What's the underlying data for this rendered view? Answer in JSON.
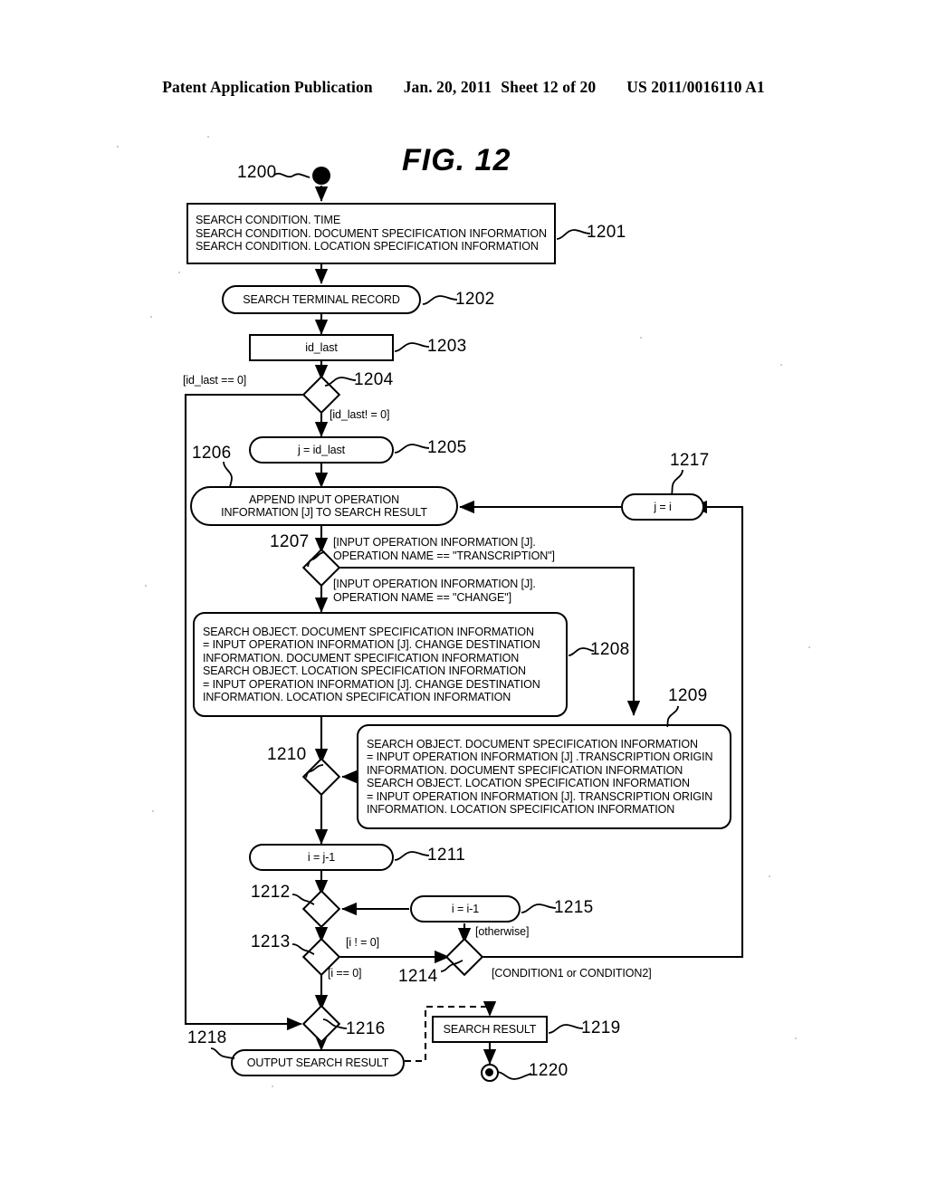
{
  "header": {
    "publication": "Patent Application Publication",
    "date": "Jan. 20, 2011",
    "sheet": "Sheet 12 of 20",
    "docnum": "US 2011/0016110 A1"
  },
  "figure": {
    "title": "FIG.  12"
  },
  "nodes": {
    "n1200": {
      "ref": "1200",
      "label": ""
    },
    "n1201": {
      "ref": "1201",
      "label": "SEARCH CONDITION. TIME\nSEARCH CONDITION. DOCUMENT SPECIFICATION INFORMATION\nSEARCH CONDITION. LOCATION SPECIFICATION INFORMATION"
    },
    "n1202": {
      "ref": "1202",
      "label": "SEARCH TERMINAL RECORD"
    },
    "n1203": {
      "ref": "1203",
      "label": "id_last"
    },
    "n1204": {
      "ref": "1204",
      "label": ""
    },
    "n1205": {
      "ref": "1205",
      "label": "j = id_last"
    },
    "n1206": {
      "ref": "1206",
      "label": "APPEND INPUT OPERATION\nINFORMATION [J] TO SEARCH RESULT"
    },
    "n1207": {
      "ref": "1207",
      "label": ""
    },
    "n1208": {
      "ref": "1208",
      "label": "SEARCH OBJECT. DOCUMENT SPECIFICATION INFORMATION\n= INPUT OPERATION INFORMATION [J]. CHANGE DESTINATION\nINFORMATION. DOCUMENT SPECIFICATION INFORMATION\nSEARCH OBJECT. LOCATION SPECIFICATION INFORMATION\n= INPUT OPERATION INFORMATION [J]. CHANGE DESTINATION\nINFORMATION. LOCATION SPECIFICATION INFORMATION"
    },
    "n1209": {
      "ref": "1209",
      "label": "SEARCH OBJECT. DOCUMENT SPECIFICATION INFORMATION\n= INPUT OPERATION INFORMATION [J] .TRANSCRIPTION ORIGIN\nINFORMATION. DOCUMENT SPECIFICATION INFORMATION\nSEARCH OBJECT. LOCATION SPECIFICATION INFORMATION\n= INPUT OPERATION INFORMATION [J]. TRANSCRIPTION ORIGIN\nINFORMATION. LOCATION SPECIFICATION INFORMATION"
    },
    "n1210": {
      "ref": "1210",
      "label": ""
    },
    "n1211": {
      "ref": "1211",
      "label": "i = j-1"
    },
    "n1212": {
      "ref": "1212",
      "label": ""
    },
    "n1213": {
      "ref": "1213",
      "label": ""
    },
    "n1214": {
      "ref": "1214",
      "label": ""
    },
    "n1215": {
      "ref": "1215",
      "label": "i = i-1"
    },
    "n1216": {
      "ref": "1216",
      "label": ""
    },
    "n1217": {
      "ref": "1217",
      "label": "j = i"
    },
    "n1218": {
      "ref": "1218",
      "label": "OUTPUT SEARCH RESULT"
    },
    "n1219": {
      "ref": "1219",
      "label": "SEARCH RESULT"
    },
    "n1220": {
      "ref": "1220",
      "label": ""
    }
  },
  "guards": {
    "id_last_eq0": "[id_last == 0]",
    "id_last_ne0": "[id_last! = 0]",
    "op_transcription": "[INPUT OPERATION INFORMATION [J].\nOPERATION NAME == \"TRANSCRIPTION\"]",
    "op_change": "[INPUT OPERATION INFORMATION [J].\nOPERATION NAME == \"CHANGE\"]",
    "i_ne0": "[i ! = 0]",
    "i_eq0": "[i == 0]",
    "otherwise": "[otherwise]",
    "condition12": "[CONDITION1 or CONDITION2]"
  },
  "colors": {
    "ink": "#000000",
    "paper": "#ffffff"
  }
}
